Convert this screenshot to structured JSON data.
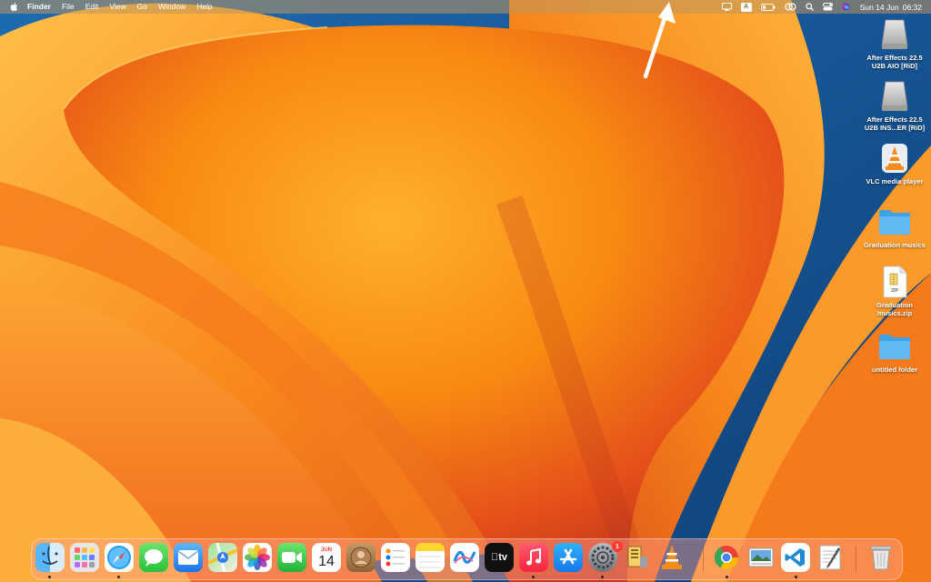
{
  "menubar": {
    "app_name": "Finder",
    "menus": [
      "File",
      "Edit",
      "View",
      "Go",
      "Window",
      "Help"
    ],
    "status_icons": [
      "screen-mirroring-icon",
      "input-source-icon",
      "battery-icon",
      "wifi-icon",
      "spotlight-search-icon",
      "control-center-icon",
      "siri-icon"
    ],
    "input_source": "A",
    "date": "Sun 14 Jun",
    "time": "06:32"
  },
  "desktop": {
    "icons": [
      {
        "label": "After Effects 22.5\nU2B AIO [RiD]",
        "icon": "disk-image-icon"
      },
      {
        "label": "After Effects 22.5\nU2B INS...ER [RiD]",
        "icon": "disk-image-icon"
      },
      {
        "label": "VLC media player",
        "icon": "vlc-icon"
      },
      {
        "label": "Graduation musics",
        "icon": "folder-icon"
      },
      {
        "label": "Graduation\nmusics.zip",
        "icon": "zip-file-icon",
        "file_tag": "ZIP"
      },
      {
        "label": "untitled folder",
        "icon": "folder-icon"
      }
    ]
  },
  "dock": {
    "apps": [
      {
        "name": "Finder",
        "icon": "finder-icon",
        "running": true
      },
      {
        "name": "Launchpad",
        "icon": "launchpad-icon",
        "running": false
      },
      {
        "name": "Safari",
        "icon": "safari-icon",
        "running": true
      },
      {
        "name": "Messages",
        "icon": "messages-icon",
        "running": false
      },
      {
        "name": "Mail",
        "icon": "mail-icon",
        "running": false
      },
      {
        "name": "Maps",
        "icon": "maps-icon",
        "running": false
      },
      {
        "name": "Photos",
        "icon": "photos-icon",
        "running": false
      },
      {
        "name": "FaceTime",
        "icon": "facetime-icon",
        "running": false
      },
      {
        "name": "Calendar",
        "icon": "calendar-icon",
        "running": false,
        "month": "JUN",
        "day": "14"
      },
      {
        "name": "Contacts",
        "icon": "contacts-icon",
        "running": false
      },
      {
        "name": "Reminders",
        "icon": "reminders-icon",
        "running": false
      },
      {
        "name": "Notes",
        "icon": "notes-icon",
        "running": false
      },
      {
        "name": "Freeform",
        "icon": "freeform-icon",
        "running": false
      },
      {
        "name": "TV",
        "icon": "tv-icon",
        "running": false,
        "text": "tv"
      },
      {
        "name": "Music",
        "icon": "music-icon",
        "running": true
      },
      {
        "name": "App Store",
        "icon": "app-store-icon",
        "running": false
      },
      {
        "name": "System Settings",
        "icon": "system-settings-icon",
        "running": true,
        "badge": "1"
      },
      {
        "name": "Archive Utility",
        "icon": "archive-utility-icon",
        "running": false
      },
      {
        "name": "VLC",
        "icon": "vlc-icon",
        "running": false
      },
      {
        "name": "Google Chrome",
        "icon": "chrome-icon",
        "running": true
      },
      {
        "name": "Preview",
        "icon": "preview-icon",
        "running": false
      },
      {
        "name": "Visual Studio Code",
        "icon": "vscode-icon",
        "running": true
      },
      {
        "name": "TextEdit",
        "icon": "textedit-icon",
        "running": false
      },
      {
        "name": "Trash",
        "icon": "trash-icon",
        "running": false
      }
    ]
  },
  "colors": {
    "wallpaper_orange": "#f7931e",
    "wallpaper_blue": "#1c5aa0",
    "badge_red": "#ff3b30"
  }
}
